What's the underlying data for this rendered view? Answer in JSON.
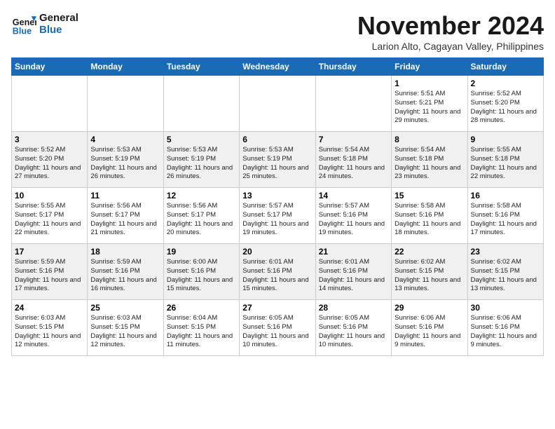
{
  "logo": {
    "line1": "General",
    "line2": "Blue"
  },
  "title": "November 2024",
  "subtitle": "Larion Alto, Cagayan Valley, Philippines",
  "headers": [
    "Sunday",
    "Monday",
    "Tuesday",
    "Wednesday",
    "Thursday",
    "Friday",
    "Saturday"
  ],
  "weeks": [
    [
      {
        "day": "",
        "info": ""
      },
      {
        "day": "",
        "info": ""
      },
      {
        "day": "",
        "info": ""
      },
      {
        "day": "",
        "info": ""
      },
      {
        "day": "",
        "info": ""
      },
      {
        "day": "1",
        "info": "Sunrise: 5:51 AM\nSunset: 5:21 PM\nDaylight: 11 hours and 29 minutes."
      },
      {
        "day": "2",
        "info": "Sunrise: 5:52 AM\nSunset: 5:20 PM\nDaylight: 11 hours and 28 minutes."
      }
    ],
    [
      {
        "day": "3",
        "info": "Sunrise: 5:52 AM\nSunset: 5:20 PM\nDaylight: 11 hours and 27 minutes."
      },
      {
        "day": "4",
        "info": "Sunrise: 5:53 AM\nSunset: 5:19 PM\nDaylight: 11 hours and 26 minutes."
      },
      {
        "day": "5",
        "info": "Sunrise: 5:53 AM\nSunset: 5:19 PM\nDaylight: 11 hours and 26 minutes."
      },
      {
        "day": "6",
        "info": "Sunrise: 5:53 AM\nSunset: 5:19 PM\nDaylight: 11 hours and 25 minutes."
      },
      {
        "day": "7",
        "info": "Sunrise: 5:54 AM\nSunset: 5:18 PM\nDaylight: 11 hours and 24 minutes."
      },
      {
        "day": "8",
        "info": "Sunrise: 5:54 AM\nSunset: 5:18 PM\nDaylight: 11 hours and 23 minutes."
      },
      {
        "day": "9",
        "info": "Sunrise: 5:55 AM\nSunset: 5:18 PM\nDaylight: 11 hours and 22 minutes."
      }
    ],
    [
      {
        "day": "10",
        "info": "Sunrise: 5:55 AM\nSunset: 5:17 PM\nDaylight: 11 hours and 22 minutes."
      },
      {
        "day": "11",
        "info": "Sunrise: 5:56 AM\nSunset: 5:17 PM\nDaylight: 11 hours and 21 minutes."
      },
      {
        "day": "12",
        "info": "Sunrise: 5:56 AM\nSunset: 5:17 PM\nDaylight: 11 hours and 20 minutes."
      },
      {
        "day": "13",
        "info": "Sunrise: 5:57 AM\nSunset: 5:17 PM\nDaylight: 11 hours and 19 minutes."
      },
      {
        "day": "14",
        "info": "Sunrise: 5:57 AM\nSunset: 5:16 PM\nDaylight: 11 hours and 19 minutes."
      },
      {
        "day": "15",
        "info": "Sunrise: 5:58 AM\nSunset: 5:16 PM\nDaylight: 11 hours and 18 minutes."
      },
      {
        "day": "16",
        "info": "Sunrise: 5:58 AM\nSunset: 5:16 PM\nDaylight: 11 hours and 17 minutes."
      }
    ],
    [
      {
        "day": "17",
        "info": "Sunrise: 5:59 AM\nSunset: 5:16 PM\nDaylight: 11 hours and 17 minutes."
      },
      {
        "day": "18",
        "info": "Sunrise: 5:59 AM\nSunset: 5:16 PM\nDaylight: 11 hours and 16 minutes."
      },
      {
        "day": "19",
        "info": "Sunrise: 6:00 AM\nSunset: 5:16 PM\nDaylight: 11 hours and 15 minutes."
      },
      {
        "day": "20",
        "info": "Sunrise: 6:01 AM\nSunset: 5:16 PM\nDaylight: 11 hours and 15 minutes."
      },
      {
        "day": "21",
        "info": "Sunrise: 6:01 AM\nSunset: 5:16 PM\nDaylight: 11 hours and 14 minutes."
      },
      {
        "day": "22",
        "info": "Sunrise: 6:02 AM\nSunset: 5:15 PM\nDaylight: 11 hours and 13 minutes."
      },
      {
        "day": "23",
        "info": "Sunrise: 6:02 AM\nSunset: 5:15 PM\nDaylight: 11 hours and 13 minutes."
      }
    ],
    [
      {
        "day": "24",
        "info": "Sunrise: 6:03 AM\nSunset: 5:15 PM\nDaylight: 11 hours and 12 minutes."
      },
      {
        "day": "25",
        "info": "Sunrise: 6:03 AM\nSunset: 5:15 PM\nDaylight: 11 hours and 12 minutes."
      },
      {
        "day": "26",
        "info": "Sunrise: 6:04 AM\nSunset: 5:15 PM\nDaylight: 11 hours and 11 minutes."
      },
      {
        "day": "27",
        "info": "Sunrise: 6:05 AM\nSunset: 5:16 PM\nDaylight: 11 hours and 10 minutes."
      },
      {
        "day": "28",
        "info": "Sunrise: 6:05 AM\nSunset: 5:16 PM\nDaylight: 11 hours and 10 minutes."
      },
      {
        "day": "29",
        "info": "Sunrise: 6:06 AM\nSunset: 5:16 PM\nDaylight: 11 hours and 9 minutes."
      },
      {
        "day": "30",
        "info": "Sunrise: 6:06 AM\nSunset: 5:16 PM\nDaylight: 11 hours and 9 minutes."
      }
    ]
  ]
}
